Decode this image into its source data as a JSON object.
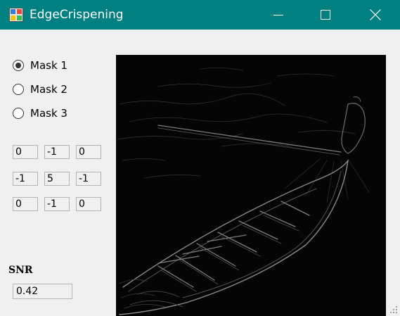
{
  "window": {
    "title": "EdgeCrispening"
  },
  "colors": {
    "titlebar": "#008080",
    "background": "#f0f0f0",
    "image_bg": "#050505"
  },
  "icons": {
    "app": "image-icon",
    "minimize": "minimize-icon",
    "maximize": "maximize-icon",
    "close": "close-icon",
    "grip": "resize-grip-icon"
  },
  "masks": [
    {
      "label": "Mask 1",
      "checked": true
    },
    {
      "label": "Mask 2",
      "checked": false
    },
    {
      "label": "Mask 3",
      "checked": false
    }
  ],
  "kernel": [
    [
      "0",
      "-1",
      "0"
    ],
    [
      "-1",
      "5",
      "-1"
    ],
    [
      "0",
      "-1",
      "0"
    ]
  ],
  "snr": {
    "label": "SNR",
    "value": "0.42"
  }
}
